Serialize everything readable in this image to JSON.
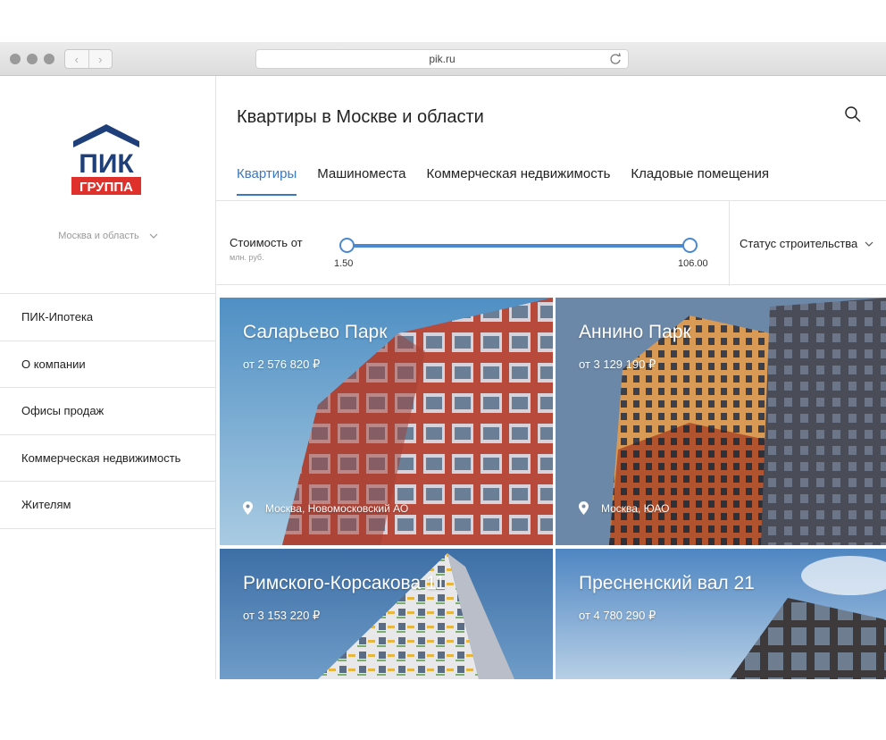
{
  "browser": {
    "url": "pik.ru"
  },
  "sidebar": {
    "city": "Москва и область",
    "menu": [
      {
        "label": "ПИК-Ипотека"
      },
      {
        "label": "О компании"
      },
      {
        "label": "Офисы продаж"
      },
      {
        "label": "Коммерческая недвижимость"
      },
      {
        "label": "Жителям"
      }
    ],
    "logo": {
      "line1": "ПИК",
      "line2": "ГРУППА"
    }
  },
  "header": {
    "title": "Квартиры в Москве и области"
  },
  "tabs": [
    {
      "label": "Квартиры",
      "active": true
    },
    {
      "label": "Машиноместа",
      "active": false
    },
    {
      "label": "Коммерческая недвижимость",
      "active": false
    },
    {
      "label": "Кладовые помещения",
      "active": false
    }
  ],
  "filters": {
    "price_label": "Стоимость от",
    "price_unit": "млн. руб.",
    "price_min": "1.50",
    "price_max": "106.00",
    "status_label": "Статус строительства"
  },
  "projects": [
    {
      "name": "Саларьево Парк",
      "price": "от 2 576 820 ₽",
      "location": "Москва, Новомосковский АО"
    },
    {
      "name": "Аннино Парк",
      "price": "от 3 129 190 ₽",
      "location": "Москва, ЮАО"
    },
    {
      "name": "Римского-Корсакова 11",
      "price": "от 3 153 220 ₽"
    },
    {
      "name": "Пресненский вал 21",
      "price": "от 4 780 290 ₽"
    }
  ],
  "colors": {
    "accent": "#3a78c2",
    "logo_blue": "#1f3f7a",
    "logo_red": "#e0302c"
  }
}
